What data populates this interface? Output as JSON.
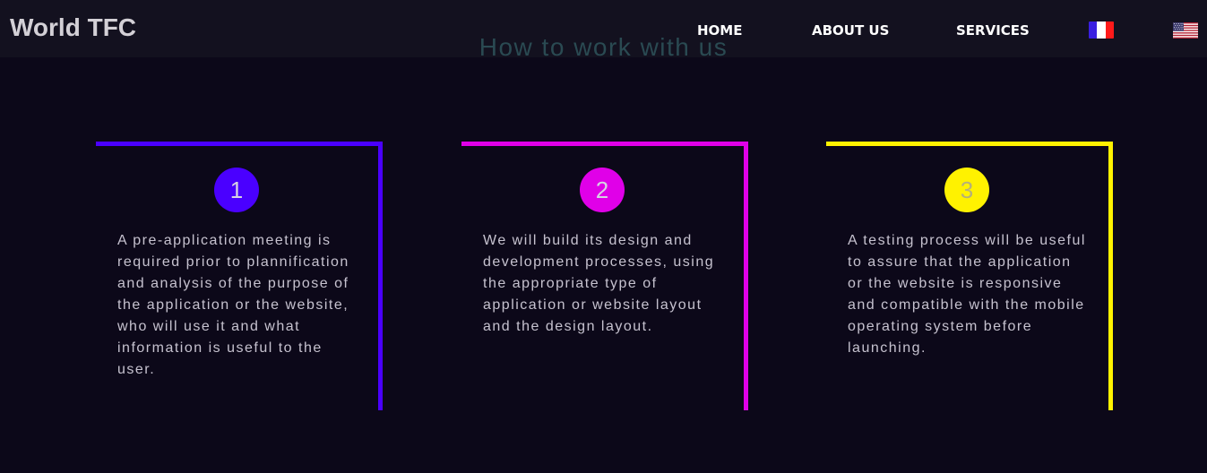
{
  "header": {
    "brand": "World TFC",
    "nav": {
      "home": "HOME",
      "about": "ABOUT US",
      "services": "SERVICES"
    },
    "languages": [
      {
        "icon": "france-flag-icon",
        "colors": [
          "#3a1fe0",
          "#ffffff",
          "#ff1a1a"
        ]
      },
      {
        "icon": "usa-flag-icon",
        "colors": [
          "#b22234",
          "#ffffff",
          "#3c3b6e"
        ]
      }
    ]
  },
  "section": {
    "title": "How to work with us",
    "steps": [
      {
        "number": "1",
        "accent": "#4a00ff",
        "text": "A pre-application meeting is required prior to plannification and analysis of the purpose of the application or the website, who will use it and what information is useful to the user."
      },
      {
        "number": "2",
        "accent": "#e000e8",
        "text": "We will build its design and development processes, using the appropriate type of application or website layout and the design layout."
      },
      {
        "number": "3",
        "accent": "#fff200",
        "text": "A testing process will be useful to assure that the application or the website is responsive and compatible with the mobile operating system before launching."
      }
    ]
  },
  "colors": {
    "background": "#0c0819",
    "navbar": "#13111f",
    "title": "#2a4a52"
  }
}
